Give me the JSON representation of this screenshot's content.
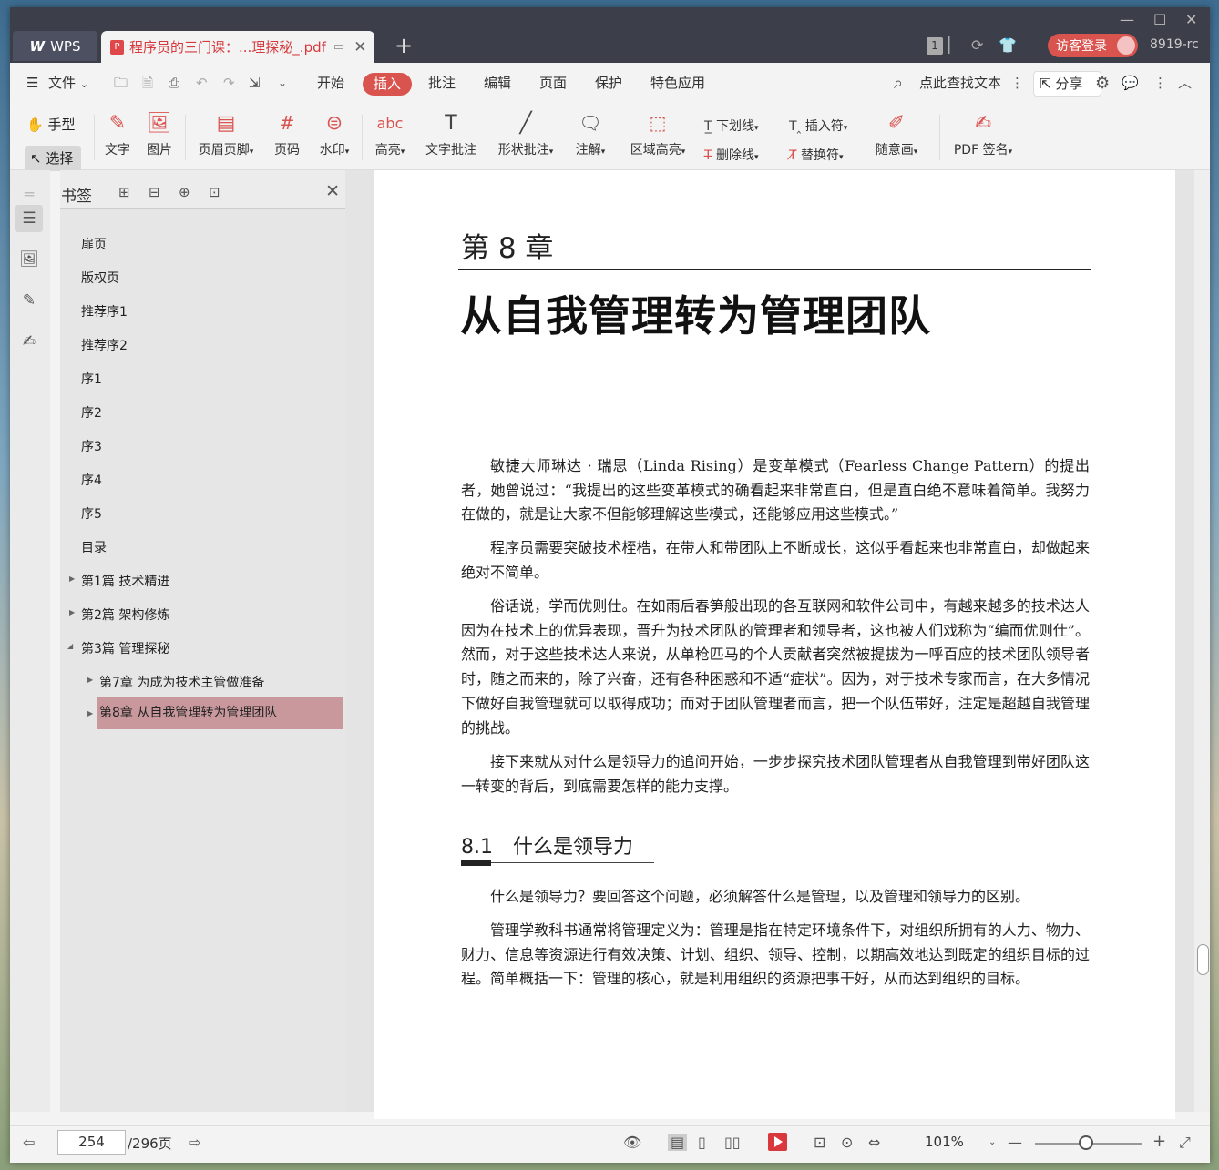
{
  "titlebar": {
    "wps_tab": "WPS",
    "doc_tab_title": "程序员的三门课：...理探秘_.pdf",
    "page_badge": "1",
    "login_label": "访客登录",
    "user_suffix": "8919-rc"
  },
  "menubar": {
    "file": "文件",
    "items": [
      "开始",
      "插入",
      "批注",
      "编辑",
      "页面",
      "保护",
      "特色应用"
    ],
    "active": "插入",
    "search": "点此查找文本",
    "share": "分享"
  },
  "ribbon": {
    "hand": "手型",
    "select": "选择",
    "text": "文字",
    "image": "图片",
    "header_footer": "页眉页脚",
    "page_number": "页码",
    "watermark": "水印",
    "highlight": "高亮",
    "text_comment": "文字批注",
    "shape_comment": "形状批注",
    "annotation": "注解",
    "area_highlight": "区域高亮",
    "underline": "下划线",
    "strikethrough": "删除线",
    "insert_mark": "插入符",
    "replace_mark": "替换符",
    "freehand": "随意画",
    "pdf_sign": "PDF 签名"
  },
  "bookmarks": {
    "title": "书签",
    "items": [
      "扉页",
      "版权页",
      "推荐序1",
      "推荐序2",
      "序1",
      "序2",
      "序3",
      "序4",
      "序5",
      "目录",
      "第1篇  技术精进",
      "第2篇  架构修炼",
      "第3篇  管理探秘"
    ],
    "sub_items": [
      "第7章  为成为技术主管做准备",
      "第8章  从自我管理转为管理团队"
    ]
  },
  "page": {
    "chapter": "第 8 章",
    "title": "从自我管理转为管理团队",
    "p1": "敏捷大师琳达 · 瑞思（Linda Rising）是变革模式（Fearless Change Pattern）的提出者，她曾说过：“我提出的这些变革模式的确看起来非常直白，但是直白绝不意味着简单。我努力在做的，就是让大家不但能够理解这些模式，还能够应用这些模式。”",
    "p2": "程序员需要突破技术桎梏，在带人和带团队上不断成长，这似乎看起来也非常直白，却做起来绝对不简单。",
    "p3": "俗话说，学而优则仕。在如雨后春笋般出现的各互联网和软件公司中，有越来越多的技术达人因为在技术上的优异表现，晋升为技术团队的管理者和领导者，这也被人们戏称为“编而优则仕”。然而，对于这些技术达人来说，从单枪匹马的个人贡献者突然被提拔为一呼百应的技术团队领导者时，随之而来的，除了兴奋，还有各种困惑和不适“症状”。因为，对于技术专家而言，在大多情况下做好自我管理就可以取得成功；而对于团队管理者而言，把一个队伍带好，注定是超越自我管理的挑战。",
    "p4": "接下来就从对什么是领导力的追问开始，一步步探究技术团队管理者从自我管理到带好团队这一转变的背后，到底需要怎样的能力支撑。",
    "section": "8.1　什么是领导力",
    "p5": "什么是领导力？要回答这个问题，必须解答什么是管理，以及管理和领导力的区别。",
    "p6": "管理学教科书通常将管理定义为：管理是指在特定环境条件下，对组织所拥有的人力、物力、财力、信息等资源进行有效决策、计划、组织、领导、控制，以期高效地达到既定的组织目标的过程。简单概括一下：管理的核心，就是利用组织的资源把事干好，从而达到组织的目标。"
  },
  "status": {
    "current_page": "254",
    "total_pages": "/296页",
    "zoom": "101%"
  }
}
